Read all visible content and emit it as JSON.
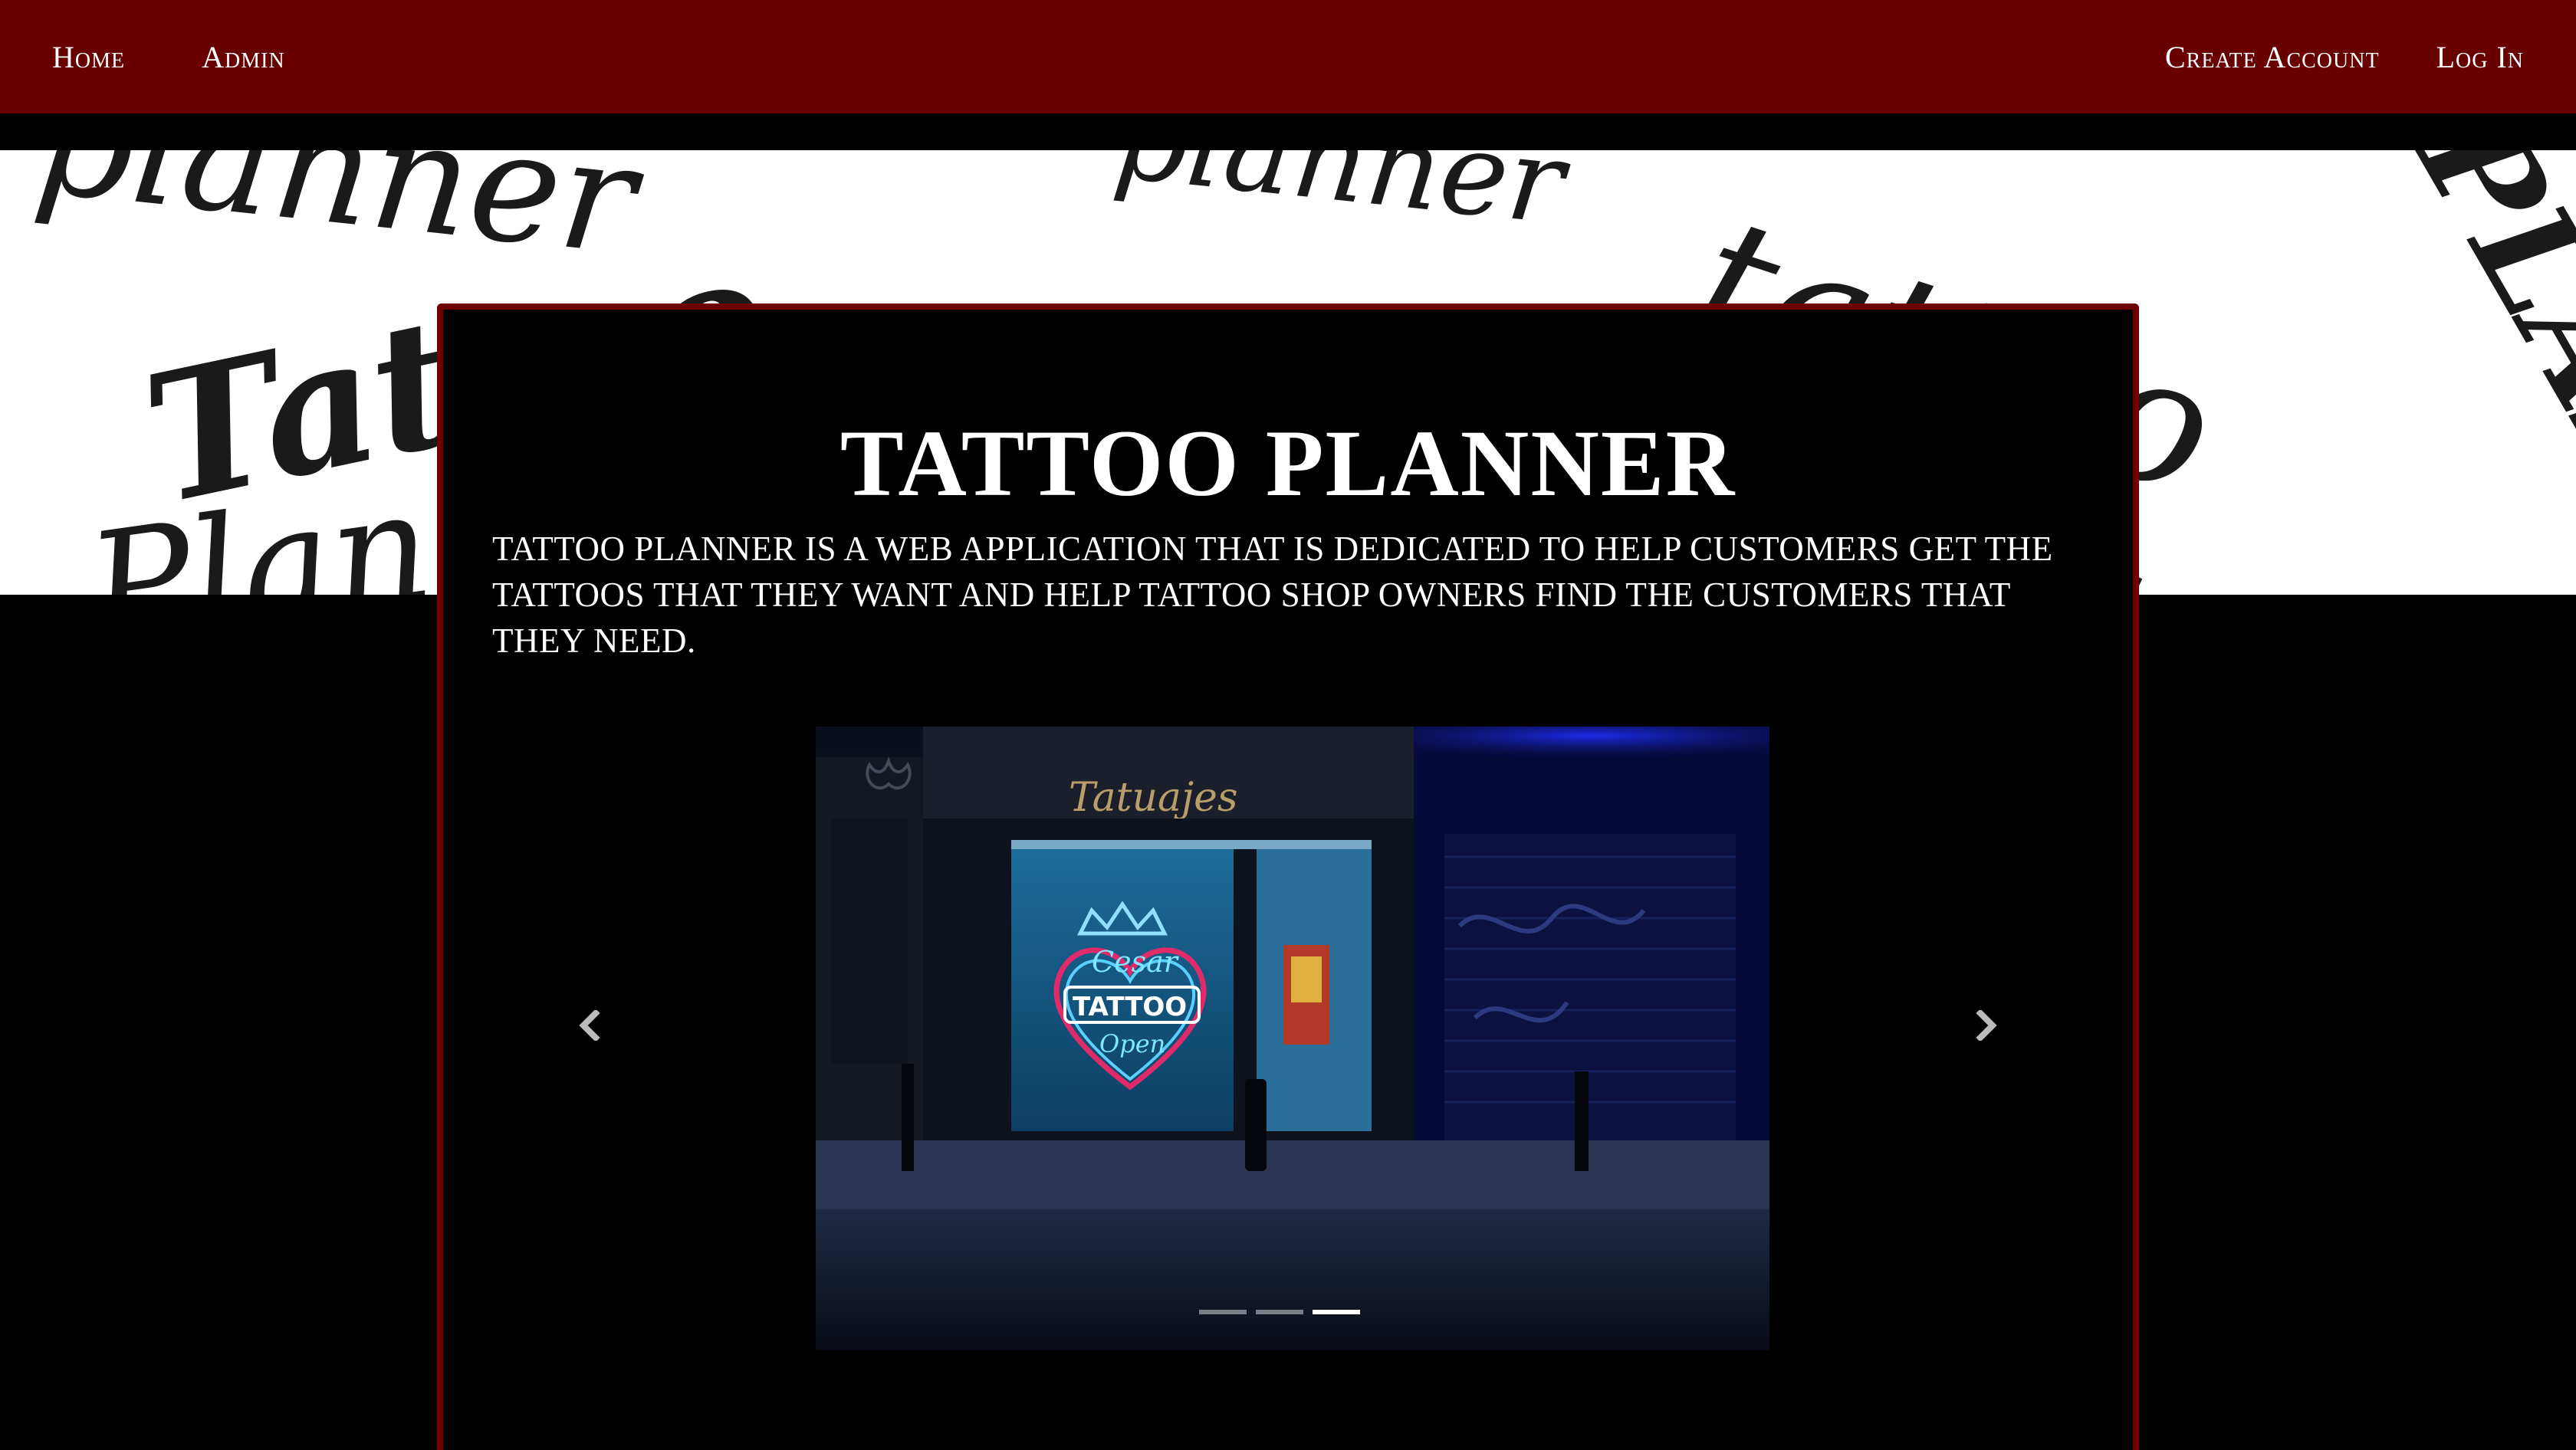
{
  "nav": {
    "left": [
      {
        "label": "Home"
      },
      {
        "label": "Admin"
      }
    ],
    "right": [
      {
        "label": "Create Account"
      },
      {
        "label": "Log In"
      }
    ]
  },
  "hero": {
    "background_words": [
      "planner",
      "Tattoo",
      "Planner",
      "tattoo",
      "PLANNER"
    ]
  },
  "main": {
    "title": "TATTOO PLANNER",
    "description": "TATTOO PLANNER IS A WEB APPLICATION THAT IS DEDICATED TO HELP CUSTOMERS GET THE TATTOOS THAT THEY WANT AND HELP TATTOO SHOP OWNERS FIND THE CUSTOMERS THAT THEY NEED."
  },
  "carousel": {
    "slide_count": 3,
    "active_index": 2,
    "prev_icon": "chevron-left-icon",
    "next_icon": "chevron-right-icon",
    "image_neon_text": [
      "Cesar",
      "TATTOO",
      "Open"
    ],
    "image_sign_text": "Tatuajes"
  },
  "colors": {
    "navbar": "#690000",
    "card_border": "#6e0000",
    "background": "#000000",
    "text": "#ffffff"
  }
}
